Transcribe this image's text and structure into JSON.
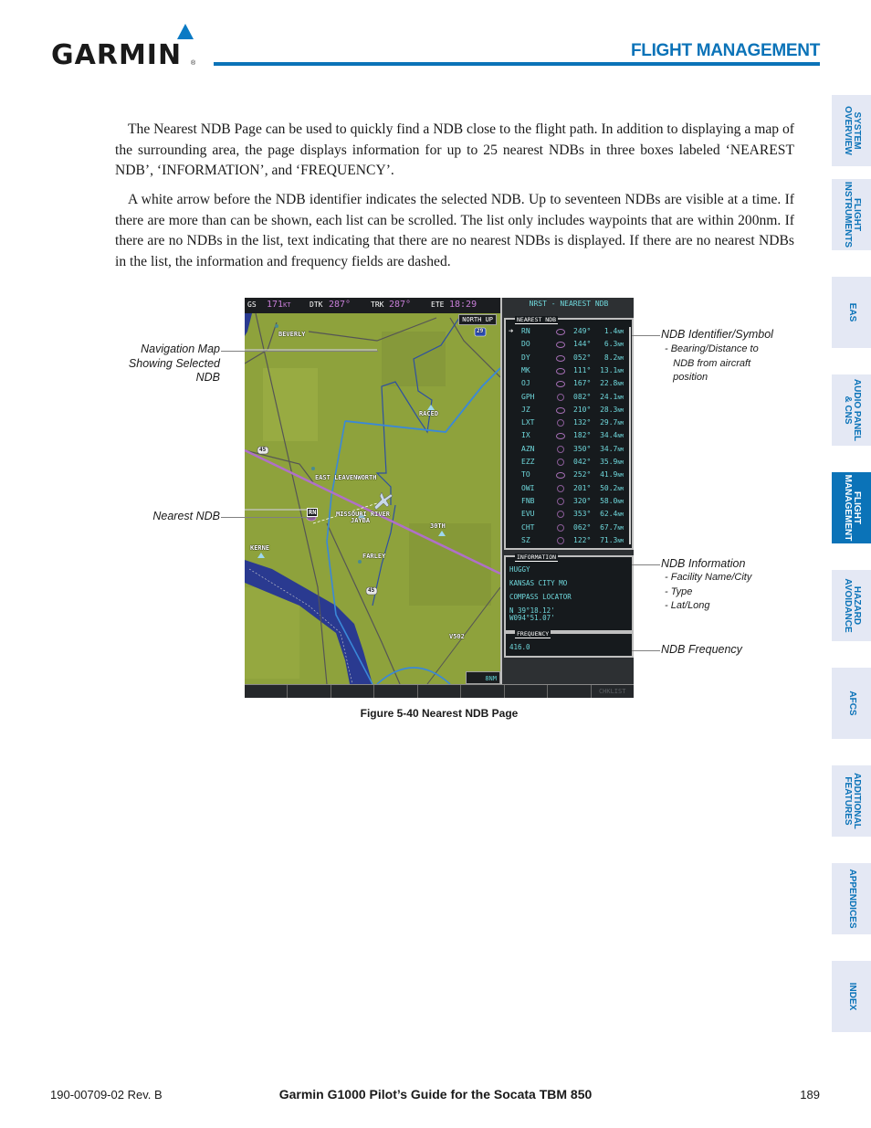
{
  "header": {
    "brand": "GARMIN",
    "section_title": "FLIGHT MANAGEMENT"
  },
  "sidebar": {
    "tabs": [
      {
        "label": "SYSTEM\nOVERVIEW",
        "active": false
      },
      {
        "label": "FLIGHT\nINSTRUMENTS",
        "active": false
      },
      {
        "label": "EAS",
        "active": false
      },
      {
        "label": "AUDIO PANEL\n& CNS",
        "active": false
      },
      {
        "label": "FLIGHT\nMANAGEMENT",
        "active": true
      },
      {
        "label": "HAZARD\nAVOIDANCE",
        "active": false
      },
      {
        "label": "AFCS",
        "active": false
      },
      {
        "label": "ADDITIONAL\nFEATURES",
        "active": false
      },
      {
        "label": "APPENDICES",
        "active": false
      },
      {
        "label": "INDEX",
        "active": false
      }
    ]
  },
  "body": {
    "paragraphs": [
      "The Nearest NDB Page can be used to quickly find a NDB close to the flight path.  In addition to displaying a map of the surrounding area, the page displays information for up to 25 nearest NDBs in three boxes labeled ‘NEAREST NDB’, ‘INFORMATION’, and ‘FREQUENCY’.",
      "A white arrow before the NDB identifier indicates the selected NDB.  Up to seventeen NDBs are visible at a time.  If there are more than can be shown, each list can be scrolled.  The list only includes waypoints that are within 200nm.  If there are no NDBs in the list, text indicating that there are no nearest NDBs is displayed.  If there are no nearest NDBs in the list, the information and frequency fields are dashed."
    ]
  },
  "figure": {
    "caption": "Figure 5-40  Nearest NDB Page",
    "topbar": {
      "gs_label": "GS",
      "gs_value": "171",
      "gs_unit": "KT",
      "dtk_label": "DTK",
      "dtk_value": "287°",
      "trk_label": "TRK",
      "trk_value": "287°",
      "ete_label": "ETE",
      "ete_value": "18:29"
    },
    "map": {
      "orientation": "NORTH UP",
      "scale": "8NM",
      "labels": {
        "beverly": "BEVERLY",
        "raced": "RACED",
        "leavenworth": "EAST LEAVENWORTH",
        "river": "MISSOURI RIVER",
        "jayba": "JAYBA",
        "thirtieth": "30TH",
        "kerne": "KERNE",
        "farley": "FARLEY",
        "v502": "V502",
        "selected_ndb": "RN",
        "hwy_29": "29",
        "hwy_45": "45",
        "hwy_45b": "45"
      }
    },
    "panel_title": "NRST - NEAREST NDB",
    "nearest_box_title": "NEAREST NDB",
    "nearest_ndbs": [
      {
        "id": "RN",
        "symbol": "ndb",
        "bearing": "249°",
        "distance": "1.4",
        "unit": "NM",
        "selected": true
      },
      {
        "id": "DO",
        "symbol": "ndb",
        "bearing": "144°",
        "distance": "6.3",
        "unit": "NM",
        "selected": false
      },
      {
        "id": "DY",
        "symbol": "ndb",
        "bearing": "052°",
        "distance": "8.2",
        "unit": "NM",
        "selected": false
      },
      {
        "id": "MK",
        "symbol": "ndb",
        "bearing": "111°",
        "distance": "13.1",
        "unit": "NM",
        "selected": false
      },
      {
        "id": "OJ",
        "symbol": "ndb",
        "bearing": "167°",
        "distance": "22.8",
        "unit": "NM",
        "selected": false
      },
      {
        "id": "GPH",
        "symbol": "compass",
        "bearing": "082°",
        "distance": "24.1",
        "unit": "NM",
        "selected": false
      },
      {
        "id": "JZ",
        "symbol": "ndb",
        "bearing": "210°",
        "distance": "28.3",
        "unit": "NM",
        "selected": false
      },
      {
        "id": "LXT",
        "symbol": "compass",
        "bearing": "132°",
        "distance": "29.7",
        "unit": "NM",
        "selected": false
      },
      {
        "id": "IX",
        "symbol": "ndb",
        "bearing": "182°",
        "distance": "34.4",
        "unit": "NM",
        "selected": false
      },
      {
        "id": "AZN",
        "symbol": "compass",
        "bearing": "350°",
        "distance": "34.7",
        "unit": "NM",
        "selected": false
      },
      {
        "id": "EZZ",
        "symbol": "compass",
        "bearing": "042°",
        "distance": "35.9",
        "unit": "NM",
        "selected": false
      },
      {
        "id": "TO",
        "symbol": "ndb",
        "bearing": "252°",
        "distance": "41.9",
        "unit": "NM",
        "selected": false
      },
      {
        "id": "OWI",
        "symbol": "compass",
        "bearing": "201°",
        "distance": "50.2",
        "unit": "NM",
        "selected": false
      },
      {
        "id": "FNB",
        "symbol": "compass",
        "bearing": "320°",
        "distance": "58.0",
        "unit": "NM",
        "selected": false
      },
      {
        "id": "EVU",
        "symbol": "compass",
        "bearing": "353°",
        "distance": "62.4",
        "unit": "NM",
        "selected": false
      },
      {
        "id": "CHT",
        "symbol": "compass",
        "bearing": "062°",
        "distance": "67.7",
        "unit": "NM",
        "selected": false
      },
      {
        "id": "SZ",
        "symbol": "compass",
        "bearing": "122°",
        "distance": "71.3",
        "unit": "NM",
        "selected": false
      }
    ],
    "information": {
      "title": "INFORMATION",
      "name": "HUGGY",
      "city": "KANSAS CITY MO",
      "type": "COMPASS LOCATOR",
      "lat": "N 39°18.12'",
      "lon": "W094°51.07'"
    },
    "frequency": {
      "title": "FREQUENCY",
      "value": "416.0"
    },
    "softkeys": [
      "",
      "",
      "",
      "",
      "",
      "",
      "",
      "",
      "CHKLIST"
    ]
  },
  "callouts": {
    "nav_map": "Navigation Map\nShowing Selected\nNDB",
    "nearest_ndb": "Nearest NDB",
    "ndb_ident": "NDB Identifier/Symbol",
    "ndb_ident_sub": "- Bearing/Distance to\n   NDB from aircraft\n   position",
    "ndb_info": "NDB Information",
    "ndb_info_sub": "- Facility Name/City\n- Type\n- Lat/Long",
    "ndb_freq": "NDB Frequency"
  },
  "footer": {
    "doc_number": "190-00709-02  Rev. B",
    "title": "Garmin G1000 Pilot’s Guide for the Socata TBM 850",
    "page": "189"
  }
}
